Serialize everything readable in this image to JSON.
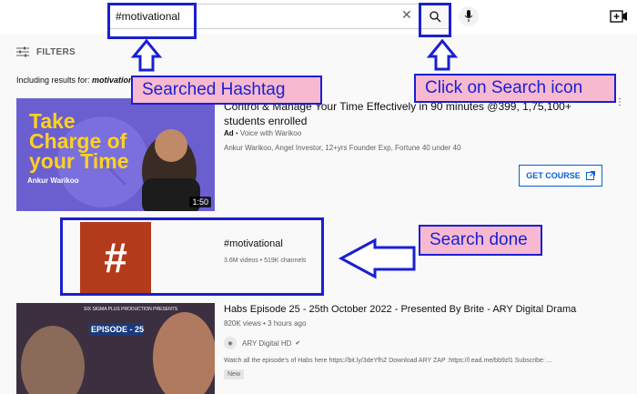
{
  "search": {
    "query": "#motivational"
  },
  "filters": {
    "label": "FILTERS"
  },
  "including": {
    "prefix": "Including results for: ",
    "term": "motivational"
  },
  "annotations": {
    "searched_hashtag": "Searched Hashtag",
    "click_search": "Click on Search icon",
    "search_done": "Search done"
  },
  "result1": {
    "thumb_title": "Take Charge of your Time",
    "thumb_name": "Ankur Warikoo",
    "duration": "1:50",
    "title": "Control & Manage Your Time Effectively in 90 minutes @399, 1,75,100+ students enrolled",
    "ad_badge": "Ad",
    "ad_channel": " • Voice with Warikoo",
    "desc": "Ankur Warikoo, Angel Investor, 12+yrs Founder Exp, Fortune 40 under 40",
    "cta": "GET COURSE"
  },
  "result2": {
    "title": "#motivational",
    "stats": "3.6M videos • 519K channels"
  },
  "result3": {
    "thumb_episode": "EPISODE - 25",
    "thumb_banner": "SIX SIGMA PLUS PRODUCTION PRESENTS",
    "title": "Habs Episode 25 - 25th October 2022 - Presented By Brite - ARY Digital Drama",
    "views": "820K views • 3 hours ago",
    "channel": "ARY Digital HD",
    "desc": "Watch all the episode's of Habs here https://bit.ly/3deYfhZ Download ARY ZAP :https://l.ead.me/bb9zl1 Subscribe: ...",
    "badge": "New"
  },
  "colors": {
    "annotation_blue": "#1a1fd1",
    "annotation_pink": "#f7b9d0",
    "cta_blue": "#065fd4",
    "hashtag_bg": "#b33a1a"
  }
}
